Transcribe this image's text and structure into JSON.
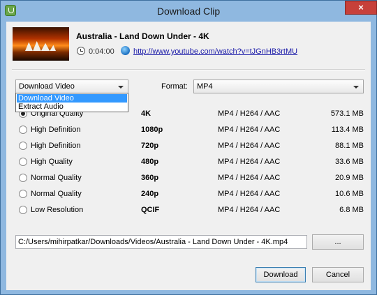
{
  "window": {
    "title": "Download Clip",
    "close_glyph": "×"
  },
  "clip": {
    "title": "Australia - Land Down Under - 4K",
    "duration": "0:04:00",
    "url": "http://www.youtube.com/watch?v=tJGnHB3rtMU"
  },
  "mode": {
    "selected": "Download Video",
    "options": [
      "Download Video",
      "Extract Audio"
    ]
  },
  "format": {
    "label": "Format:",
    "selected": "MP4"
  },
  "qualities": [
    {
      "name": "Original Quality",
      "resolution": "4K",
      "format": "MP4 / H264 / AAC",
      "size": "573.1 MB",
      "selected": true
    },
    {
      "name": "High Definition",
      "resolution": "1080p",
      "format": "MP4 / H264 / AAC",
      "size": "113.4 MB",
      "selected": false
    },
    {
      "name": "High Definition",
      "resolution": "720p",
      "format": "MP4 / H264 / AAC",
      "size": "88.1 MB",
      "selected": false
    },
    {
      "name": "High Quality",
      "resolution": "480p",
      "format": "MP4 / H264 / AAC",
      "size": "33.6 MB",
      "selected": false
    },
    {
      "name": "Normal Quality",
      "resolution": "360p",
      "format": "MP4 / H264 / AAC",
      "size": "20.9 MB",
      "selected": false
    },
    {
      "name": "Normal Quality",
      "resolution": "240p",
      "format": "MP4 / H264 / AAC",
      "size": "10.6 MB",
      "selected": false
    },
    {
      "name": "Low Resolution",
      "resolution": "QCIF",
      "format": "MP4 / H264 / AAC",
      "size": "6.8 MB",
      "selected": false
    }
  ],
  "save_path": "C:/Users/mihirpatkar/Downloads/Videos/Australia - Land Down Under - 4K.mp4",
  "buttons": {
    "browse": "...",
    "download": "Download",
    "cancel": "Cancel"
  }
}
